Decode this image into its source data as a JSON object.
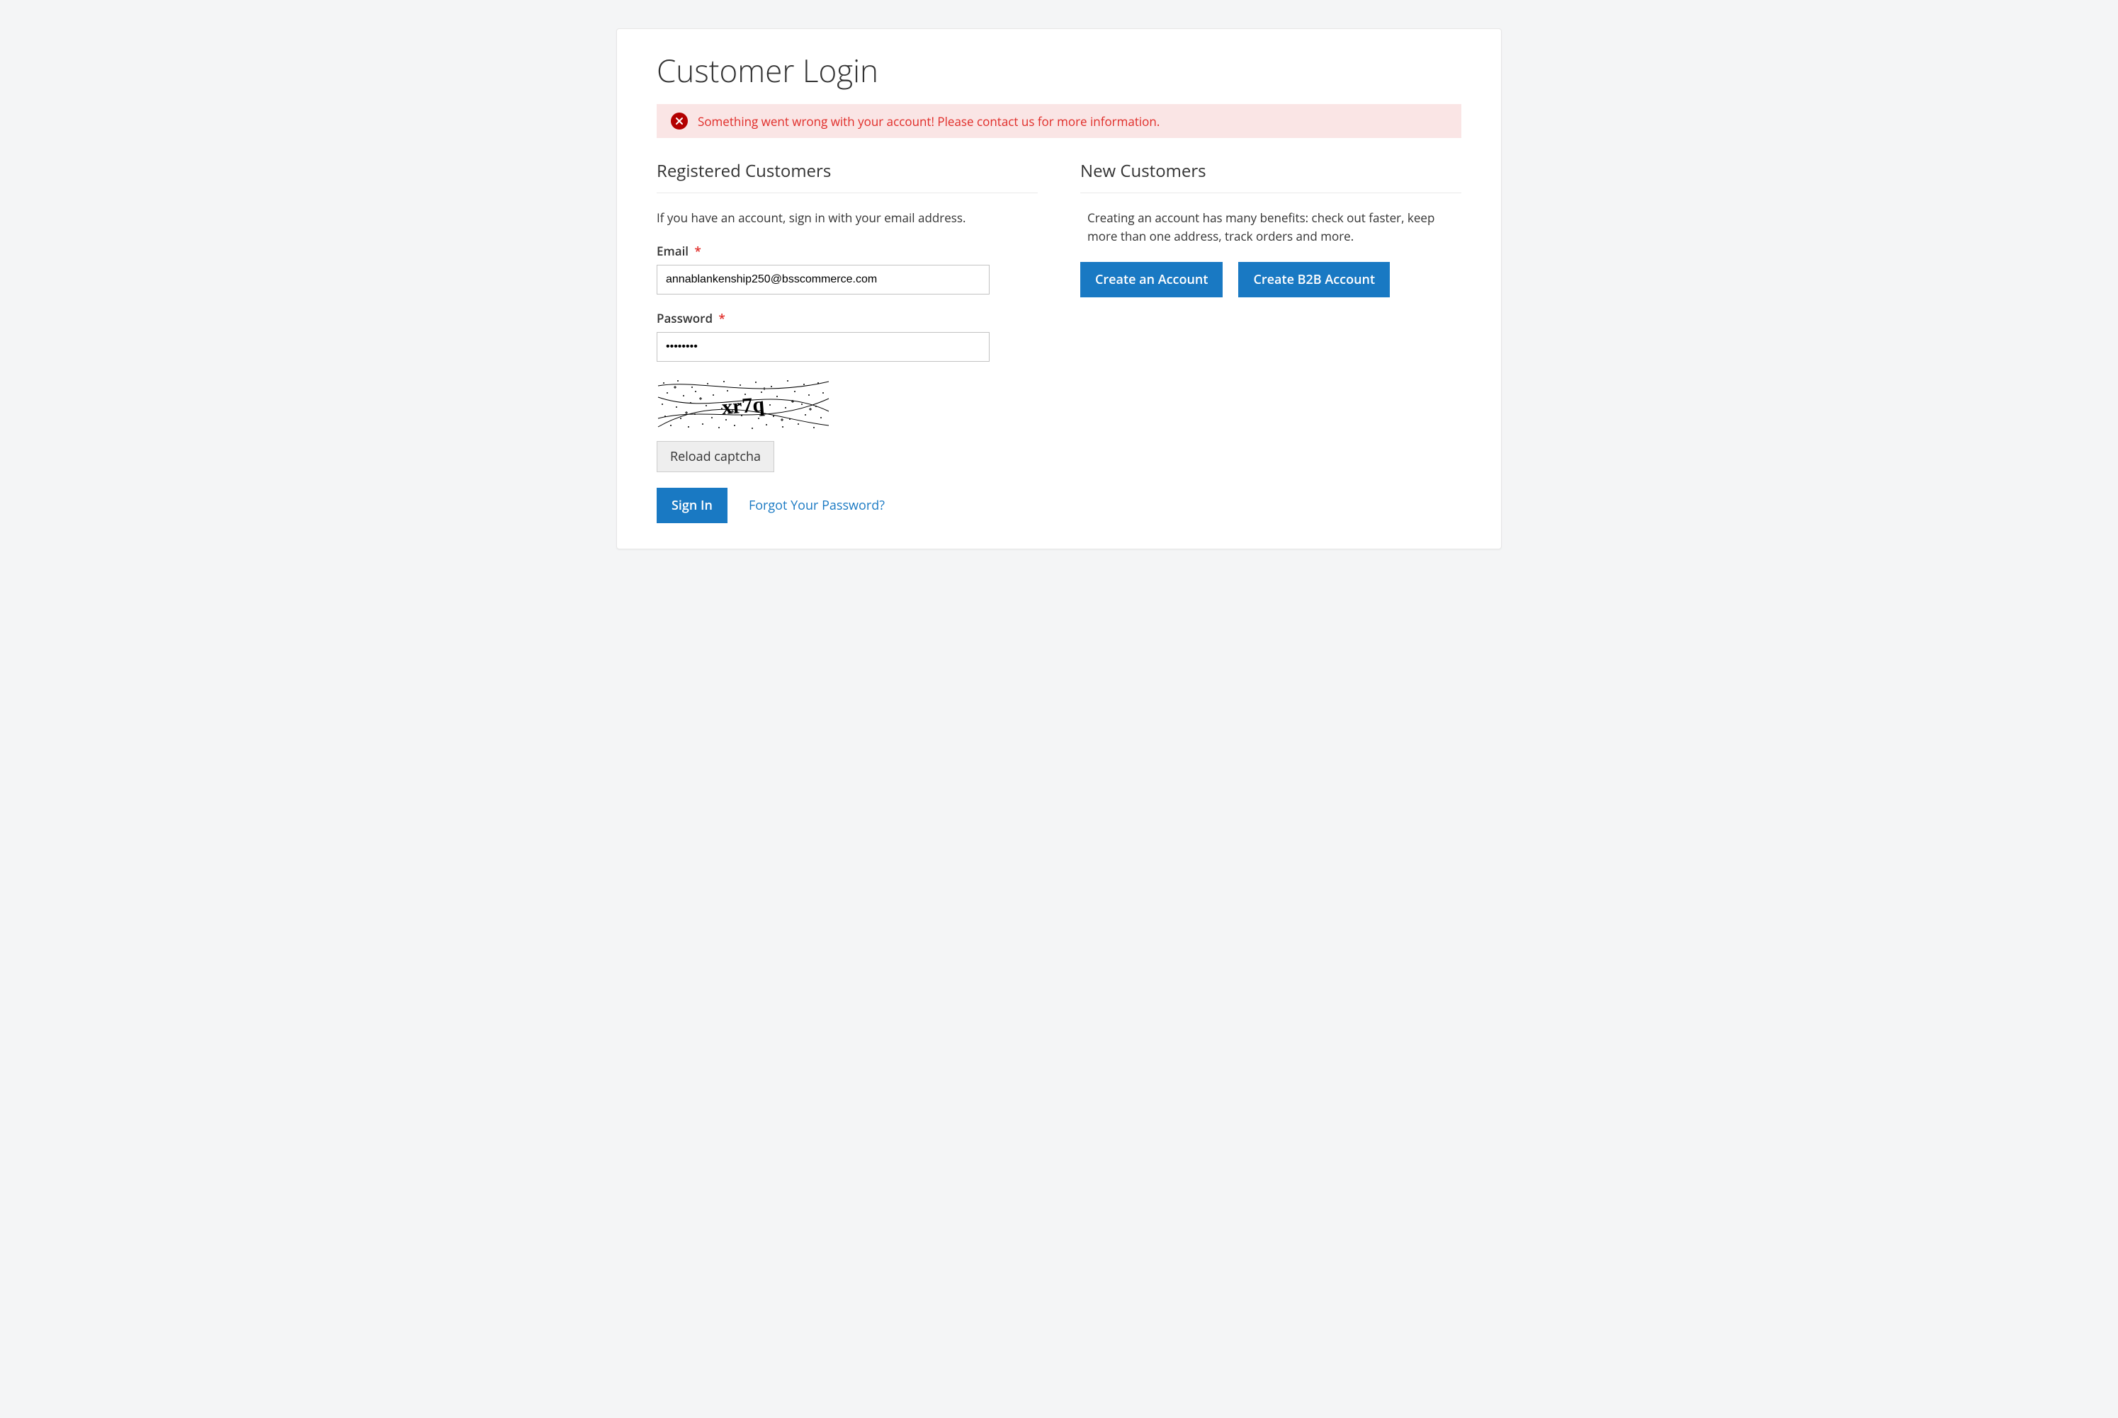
{
  "page": {
    "title": "Customer Login"
  },
  "error": {
    "message": "Something went wrong with your account! Please contact us for more information."
  },
  "login": {
    "block_title": "Registered Customers",
    "intro": "If you have an account, sign in with your email address.",
    "email_label": "Email",
    "email_value": "annablankenship250@bsscommerce.com",
    "password_label": "Password",
    "password_value": "••••••••",
    "captcha_text": "xr7q",
    "reload_label": "Reload captcha",
    "signin_label": "Sign In",
    "forgot_label": "Forgot Your Password?"
  },
  "new_customer": {
    "block_title": "New Customers",
    "intro": "Creating an account has many benefits: check out faster, keep more than one address, track orders and more.",
    "create_label": "Create an Account",
    "create_b2b_label": "Create B2B Account"
  },
  "colors": {
    "primary": "#1979c3",
    "error_bg": "#fae5e5",
    "error_text": "#e02b27"
  }
}
